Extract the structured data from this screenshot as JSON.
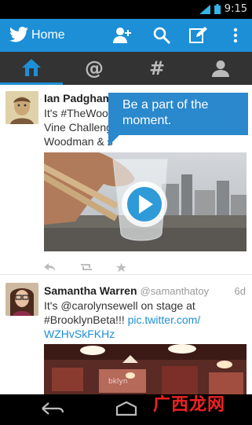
{
  "status_bar": {
    "time": "9:15"
  },
  "action_bar": {
    "title": "Home",
    "icons": [
      "bird-logo-icon",
      "add-user-icon",
      "search-icon",
      "compose-icon",
      "overflow-menu-icon"
    ]
  },
  "tabs": [
    {
      "id": "home",
      "icon": "home-icon",
      "glyph": ""
    },
    {
      "id": "mentions",
      "icon": "at-icon",
      "glyph": "@"
    },
    {
      "id": "discover",
      "icon": "hashtag-icon",
      "glyph": "#"
    },
    {
      "id": "me",
      "icon": "person-icon",
      "glyph": ""
    }
  ],
  "tooltip": {
    "text": "Be a part of the moment."
  },
  "tweets": [
    {
      "name": "Ian Padgham",
      "body": "It's #TheWood... Vine Challenge... Woodman & s...",
      "body_lines": [
        "It's #TheWood",
        "Vine Challeng",
        "Woodman & s"
      ],
      "media": "video-thumbnail",
      "actions": [
        "reply-icon",
        "retweet-icon",
        "favorite-icon"
      ]
    },
    {
      "name": "Samantha Warren",
      "handle": "@samanthatoy",
      "time": "6d",
      "body_plain": "It's @carolynsewell on stage at #BrooklynBeta!!! ",
      "body_line1": "It's @carolynsewell on stage at",
      "body_line2_plain": "#BrooklynBeta!!! ",
      "link_line2": "pic.twitter.com/",
      "link_line3": "WZHvSkFKHz",
      "media": "photo-thumbnail"
    }
  ],
  "watermark": "广西龙网",
  "colors": {
    "brand": "#1c8fd6",
    "tooltip": "#2a88cd",
    "tabbar": "#333333",
    "statusbar": "#000000"
  }
}
